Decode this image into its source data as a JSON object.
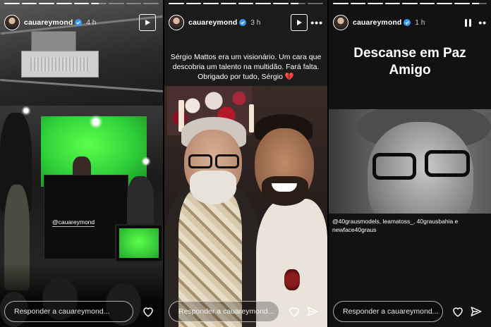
{
  "stories": [
    {
      "username": "cauareymond",
      "time": "4 h",
      "progress": [
        1,
        1,
        1,
        1,
        1,
        0.5,
        0,
        0,
        0
      ],
      "overlay_mention": "@cauareymond",
      "reply_placeholder": "Responder a cauareymond..."
    },
    {
      "username": "cauareymond",
      "time": "3 h",
      "progress": [
        1,
        1,
        1,
        1,
        1,
        1,
        1,
        0.5,
        0
      ],
      "caption": "Sérgio Mattos era um visionário. Um cara que descobria um talento na multidão. Fará falta. Obrigado por tudo, Sérgio",
      "caption_emoji": "💔",
      "reply_placeholder": "Responder a cauareymond..."
    },
    {
      "username": "cauareymond",
      "time": "1 h",
      "progress": [
        1,
        1,
        1,
        1,
        1,
        1,
        1,
        1,
        0.5
      ],
      "title": "Descanse em Paz Amigo",
      "mentions": "@40grausmodels, leamatoss_, 40grausbahia e newface40graus",
      "reply_placeholder": "Responder a cauareymond..."
    }
  ],
  "icons": {
    "verified": "verified-badge-icon",
    "play": "play-icon",
    "pause": "pause-icon",
    "more": "more-icon",
    "heart": "heart-icon",
    "send": "send-icon"
  },
  "colors": {
    "verified": "#3897f0",
    "green_screen": "#2fd13a",
    "broken_heart": "#e0245e"
  }
}
